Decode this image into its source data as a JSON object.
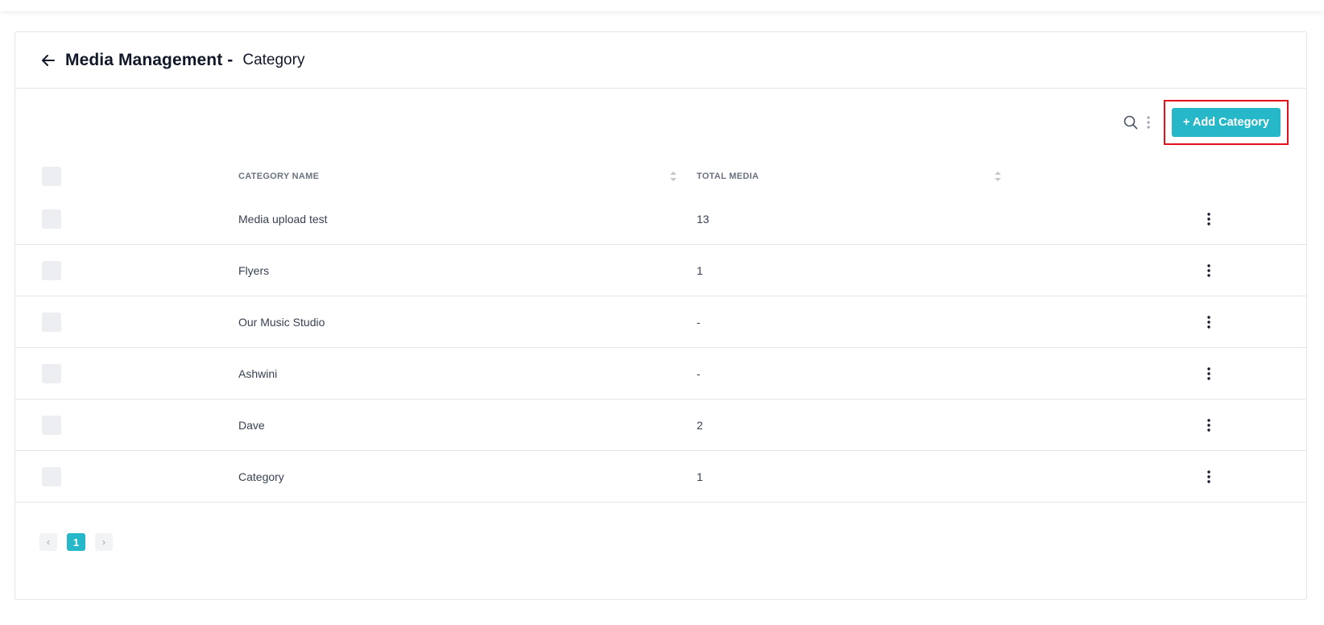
{
  "header": {
    "title": "Media Management -",
    "subtitle": "Category"
  },
  "toolbar": {
    "add_button_label": "+ Add Category",
    "search_icon": "search-icon",
    "more_icon": "vertical-dots-icon"
  },
  "table": {
    "columns": [
      "CATEGORY NAME",
      "TOTAL MEDIA"
    ],
    "rows": [
      {
        "name": "Media upload test",
        "total": "13"
      },
      {
        "name": "Flyers",
        "total": "1"
      },
      {
        "name": "Our Music Studio",
        "total": "-"
      },
      {
        "name": "Ashwini",
        "total": "-"
      },
      {
        "name": "Dave",
        "total": "2"
      },
      {
        "name": "Category",
        "total": "1"
      }
    ]
  },
  "pagination": {
    "prev": "‹",
    "current_page": "1",
    "next": "›"
  },
  "colors": {
    "accent": "#26b8c8",
    "highlight": "#e3101b",
    "border": "#e3e5ea"
  }
}
